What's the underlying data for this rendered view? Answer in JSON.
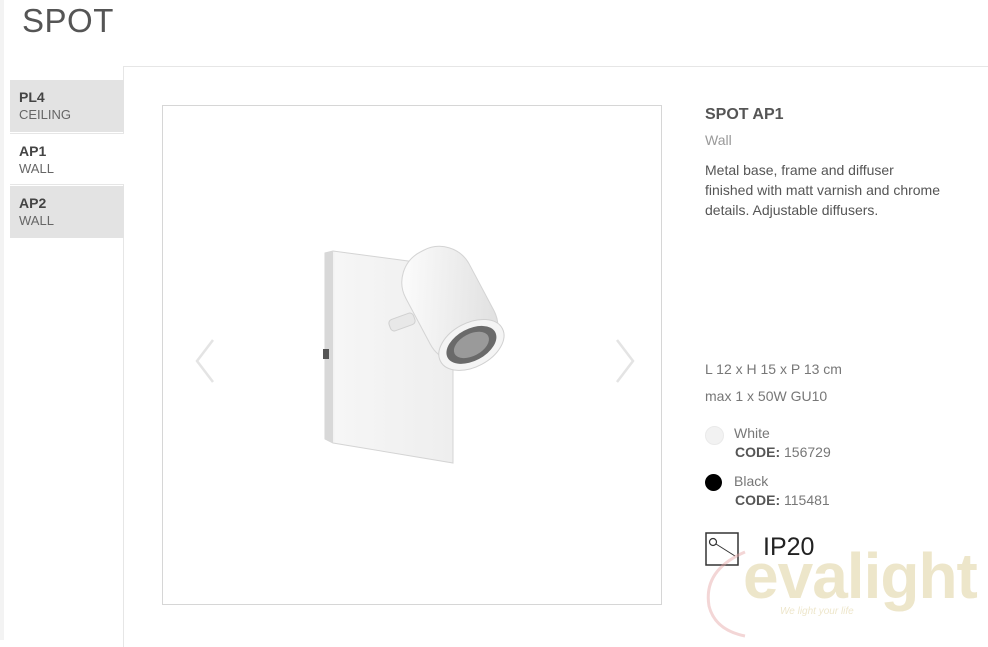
{
  "page": {
    "title": "SPOT"
  },
  "sidebar": {
    "items": [
      {
        "code": "PL4",
        "sub": "CEILING",
        "active": false
      },
      {
        "code": "AP1",
        "sub": "WALL",
        "active": true
      },
      {
        "code": "AP2",
        "sub": "WALL",
        "active": false
      }
    ]
  },
  "gallery": {
    "prev_icon": "chevron-left-icon",
    "next_icon": "chevron-right-icon"
  },
  "product": {
    "title": "SPOT AP1",
    "type": "Wall",
    "description": "Metal base, frame and diffuser finished with matt varnish and chrome details. Adjustable diffusers.",
    "dimensions": "L 12 x H 15 x P 13 cm",
    "bulb": "max 1 x 50W GU10",
    "variants": [
      {
        "color_name": "White",
        "code_label": "CODE:",
        "code": "156729",
        "swatch": "#f2f2f2"
      },
      {
        "color_name": "Black",
        "code_label": "CODE:",
        "code": "115481",
        "swatch": "#000000"
      }
    ],
    "ip_rating": "IP20"
  },
  "watermark": {
    "brand": "evalight",
    "tagline": "We light your life"
  }
}
